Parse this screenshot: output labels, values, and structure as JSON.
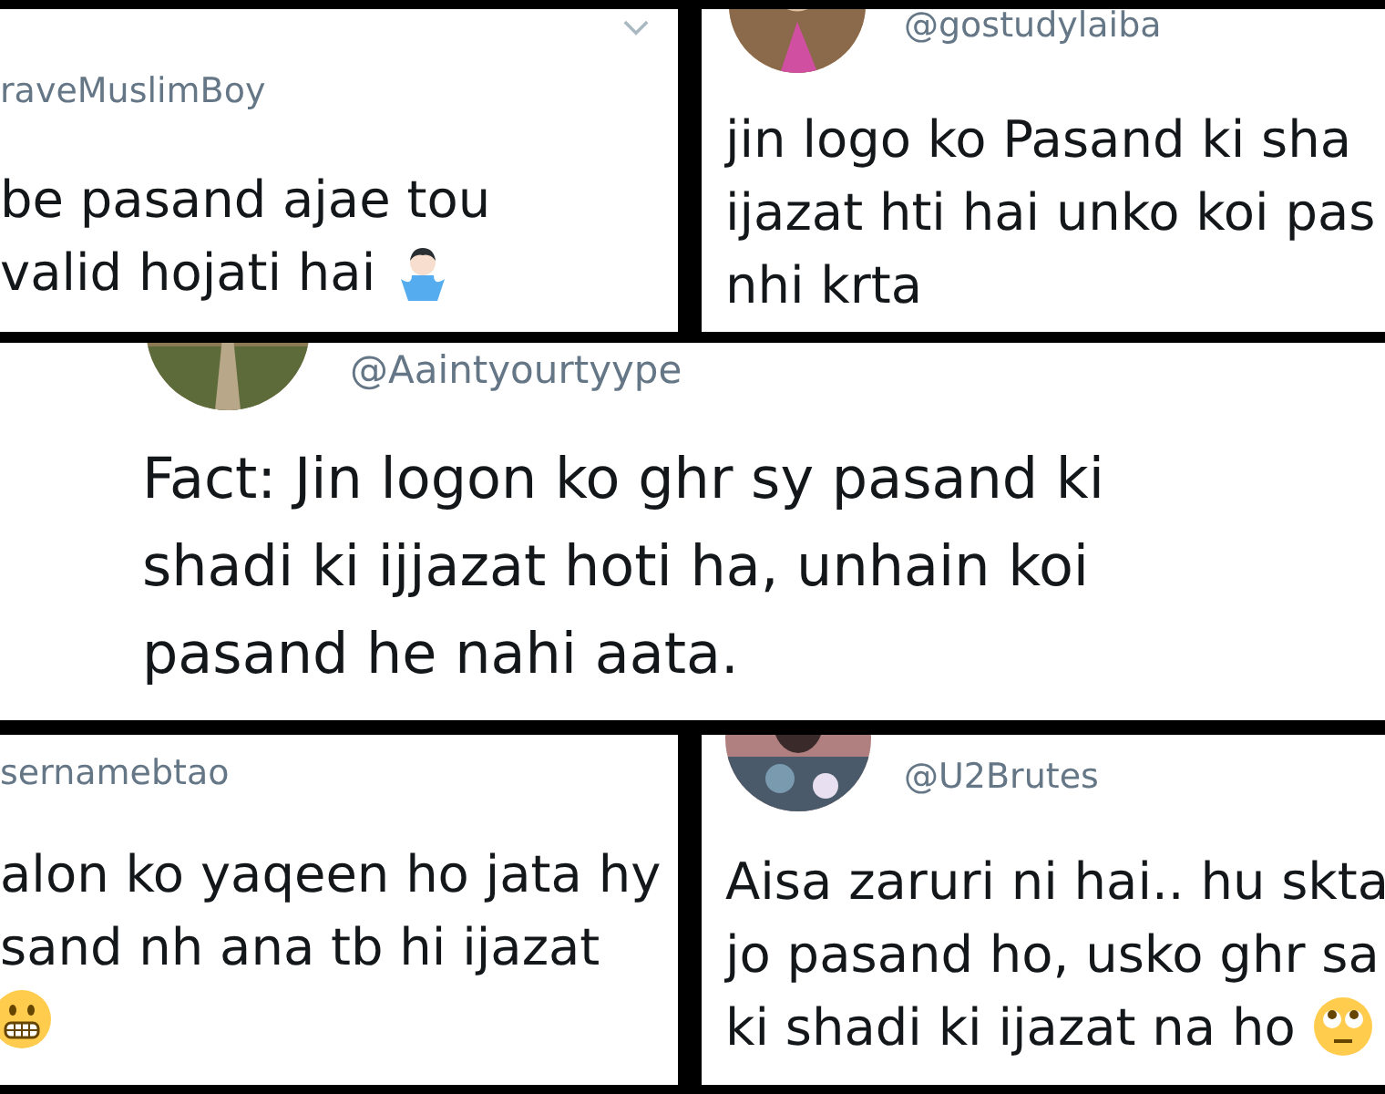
{
  "tweets": [
    {
      "handle": "raveMuslimBoy",
      "menu_chevron": true,
      "lines": [
        {
          "kind": "plain",
          "text": "be pasand ajae tou"
        },
        {
          "kind": "shrug",
          "text": "valid hojati hai"
        }
      ]
    },
    {
      "handle": "@gostudylaiba",
      "lines": [
        {
          "kind": "plain",
          "text": "jin logo ko Pasand ki sha"
        },
        {
          "kind": "plain",
          "text": "ijazat hti hai unko koi pas"
        },
        {
          "kind": "plain",
          "text": "nhi krta"
        }
      ]
    },
    {
      "handle": "@Aaintyourtyype",
      "lines": [
        {
          "kind": "plain",
          "text": "Fact: Jin logon ko ghr sy pasand ki"
        },
        {
          "kind": "plain",
          "text": "shadi ki ijjazat hoti ha, unhain koi"
        },
        {
          "kind": "plain",
          "text": "pasand he nahi aata."
        }
      ]
    },
    {
      "handle": "sernamebtao",
      "lines": [
        {
          "kind": "plain",
          "text": "alon ko yaqeen ho jata hy"
        },
        {
          "kind": "plain",
          "text": "sand nh ana tb hi ijazat"
        },
        {
          "kind": "grimace"
        }
      ]
    },
    {
      "handle": "@U2Brutes",
      "lines": [
        {
          "kind": "plain",
          "text": "Aisa zaruri ni hai.. hu skta"
        },
        {
          "kind": "plain",
          "text": "jo pasand ho, usko ghr sa"
        },
        {
          "kind": "rolleyes",
          "text": "ki shadi ki ijazat na ho"
        }
      ]
    }
  ]
}
